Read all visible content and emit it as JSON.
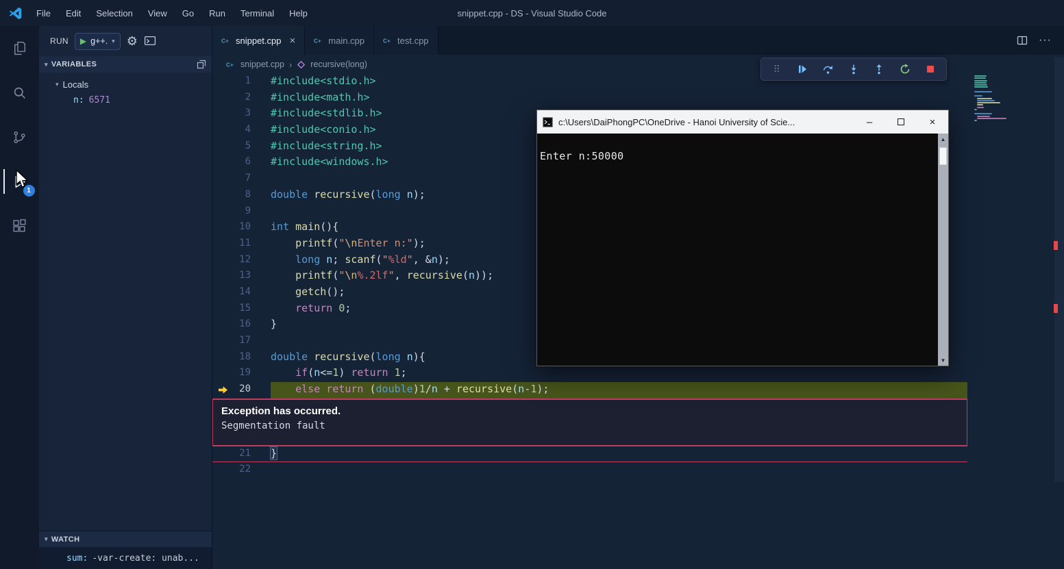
{
  "window": {
    "title": "snippet.cpp - DS - Visual Studio Code"
  },
  "menu": {
    "items": [
      "File",
      "Edit",
      "Selection",
      "View",
      "Go",
      "Run",
      "Terminal",
      "Help"
    ]
  },
  "activity_bar": {
    "badge": "1",
    "active_item": "run-and-debug"
  },
  "sidebar": {
    "run_label": "RUN",
    "config": "g++.",
    "variables_header": "VARIABLES",
    "locals": "Locals",
    "variables": [
      {
        "name": "n:",
        "value": "6571"
      }
    ],
    "watch_header": "WATCH",
    "watch": [
      {
        "name": "sum:",
        "value": "-var-create: unab..."
      }
    ]
  },
  "tabs": [
    {
      "label": "snippet.cpp",
      "active": true
    },
    {
      "label": "main.cpp",
      "active": false
    },
    {
      "label": "test.cpp",
      "active": false
    }
  ],
  "breadcrumb": {
    "file": "snippet.cpp",
    "symbol": "recursive(long)"
  },
  "editor": {
    "exception": {
      "after_line": 20,
      "title": "Exception has occurred.",
      "message": "Segmentation fault"
    },
    "lines": [
      {
        "n": 1,
        "t": [
          [
            "inc",
            "#include<stdio.h>"
          ]
        ]
      },
      {
        "n": 2,
        "t": [
          [
            "inc",
            "#include<math.h>"
          ]
        ]
      },
      {
        "n": 3,
        "t": [
          [
            "inc",
            "#include<stdlib.h>"
          ]
        ]
      },
      {
        "n": 4,
        "t": [
          [
            "inc",
            "#include<conio.h>"
          ]
        ]
      },
      {
        "n": 5,
        "t": [
          [
            "inc",
            "#include<string.h>"
          ]
        ]
      },
      {
        "n": 6,
        "t": [
          [
            "inc",
            "#include<windows.h>"
          ]
        ]
      },
      {
        "n": 7,
        "t": []
      },
      {
        "n": 8,
        "t": [
          [
            "kw",
            "double"
          ],
          [
            "pl",
            " "
          ],
          [
            "fn",
            "recursive"
          ],
          [
            "pl",
            "("
          ],
          [
            "kw",
            "long"
          ],
          [
            "pl",
            " "
          ],
          [
            "vr",
            "n"
          ],
          [
            "pl",
            ");"
          ]
        ]
      },
      {
        "n": 9,
        "t": []
      },
      {
        "n": 10,
        "t": [
          [
            "kw",
            "int"
          ],
          [
            "pl",
            " "
          ],
          [
            "fn",
            "main"
          ],
          [
            "pl",
            "(){"
          ]
        ]
      },
      {
        "n": 11,
        "t": [
          [
            "pl",
            "    "
          ],
          [
            "fn",
            "printf"
          ],
          [
            "pl",
            "("
          ],
          [
            "st",
            "\""
          ],
          [
            "es",
            "\\n"
          ],
          [
            "st",
            "Enter n:\""
          ],
          [
            "pl",
            ");"
          ]
        ]
      },
      {
        "n": 12,
        "t": [
          [
            "pl",
            "    "
          ],
          [
            "kw",
            "long"
          ],
          [
            "pl",
            " "
          ],
          [
            "vr",
            "n"
          ],
          [
            "pl",
            "; "
          ],
          [
            "fn",
            "scanf"
          ],
          [
            "pl",
            "("
          ],
          [
            "st",
            "\""
          ],
          [
            "fm",
            "%ld"
          ],
          [
            "st",
            "\""
          ],
          [
            "pl",
            ", &"
          ],
          [
            "vr",
            "n"
          ],
          [
            "pl",
            ");"
          ]
        ]
      },
      {
        "n": 13,
        "t": [
          [
            "pl",
            "    "
          ],
          [
            "fn",
            "printf"
          ],
          [
            "pl",
            "("
          ],
          [
            "st",
            "\""
          ],
          [
            "es",
            "\\n"
          ],
          [
            "fm",
            "%.2lf"
          ],
          [
            "st",
            "\""
          ],
          [
            "pl",
            ", "
          ],
          [
            "fn",
            "recursive"
          ],
          [
            "pl",
            "("
          ],
          [
            "vr",
            "n"
          ],
          [
            "pl",
            "));"
          ]
        ]
      },
      {
        "n": 14,
        "t": [
          [
            "pl",
            "    "
          ],
          [
            "fn",
            "getch"
          ],
          [
            "pl",
            "();"
          ]
        ]
      },
      {
        "n": 15,
        "t": [
          [
            "pl",
            "    "
          ],
          [
            "ct",
            "return"
          ],
          [
            "pl",
            " "
          ],
          [
            "nm",
            "0"
          ],
          [
            "pl",
            ";"
          ]
        ]
      },
      {
        "n": 16,
        "t": [
          [
            "pl",
            "}"
          ]
        ]
      },
      {
        "n": 17,
        "t": []
      },
      {
        "n": 18,
        "t": [
          [
            "kw",
            "double"
          ],
          [
            "pl",
            " "
          ],
          [
            "fn",
            "recursive"
          ],
          [
            "pl",
            "("
          ],
          [
            "kw",
            "long"
          ],
          [
            "pl",
            " "
          ],
          [
            "vr",
            "n"
          ],
          [
            "pl",
            "){"
          ]
        ]
      },
      {
        "n": 19,
        "t": [
          [
            "pl",
            "    "
          ],
          [
            "ct",
            "if"
          ],
          [
            "pl",
            "("
          ],
          [
            "vr",
            "n"
          ],
          [
            "pl",
            "<="
          ],
          [
            "nm",
            "1"
          ],
          [
            "pl",
            ") "
          ],
          [
            "ct",
            "return"
          ],
          [
            "pl",
            " "
          ],
          [
            "nm",
            "1"
          ],
          [
            "pl",
            ";"
          ]
        ]
      },
      {
        "n": 20,
        "cur": true,
        "t": [
          [
            "pl",
            "    "
          ],
          [
            "ct",
            "else"
          ],
          [
            "pl",
            " "
          ],
          [
            "ct",
            "return"
          ],
          [
            "pl",
            " ("
          ],
          [
            "kw",
            "double"
          ],
          [
            "pl",
            ")"
          ],
          [
            "nm",
            "1"
          ],
          [
            "pl",
            "/"
          ],
          [
            "vr",
            "n"
          ],
          [
            "pl",
            " + "
          ],
          [
            "fn",
            "recursive"
          ],
          [
            "pl",
            "("
          ],
          [
            "vr",
            "n"
          ],
          [
            "pl",
            "-"
          ],
          [
            "nm",
            "1"
          ],
          [
            "pl",
            ");"
          ]
        ]
      },
      {
        "n": 21,
        "exc_underline": true,
        "t": [
          [
            "bk",
            "}"
          ]
        ]
      },
      {
        "n": 22,
        "t": []
      }
    ]
  },
  "console": {
    "title": "c:\\Users\\DaiPhongPC\\OneDrive - Hanoi University of Scie...",
    "output": "Enter n:50000"
  },
  "colors": {
    "accent_blue": "#75beff",
    "debug_green": "#89d185",
    "debug_red": "#f14c4c",
    "exception_border": "#bf3d5f",
    "current_line_highlight": "#47541a"
  }
}
